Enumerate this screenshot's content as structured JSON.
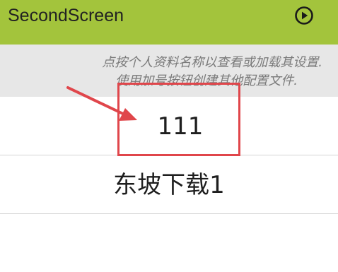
{
  "app_bar": {
    "title": "SecondScreen",
    "background": "#a3c43c",
    "play_icon": "play-circle-icon"
  },
  "hint": {
    "line1": "点按个人资料名称以查看或加载其设置.",
    "line2": "使用加号按钮创建其他配置文件."
  },
  "profiles": [
    {
      "label": "111"
    },
    {
      "label": "东坡下载1"
    }
  ],
  "annotation": {
    "color": "#e0464b"
  }
}
